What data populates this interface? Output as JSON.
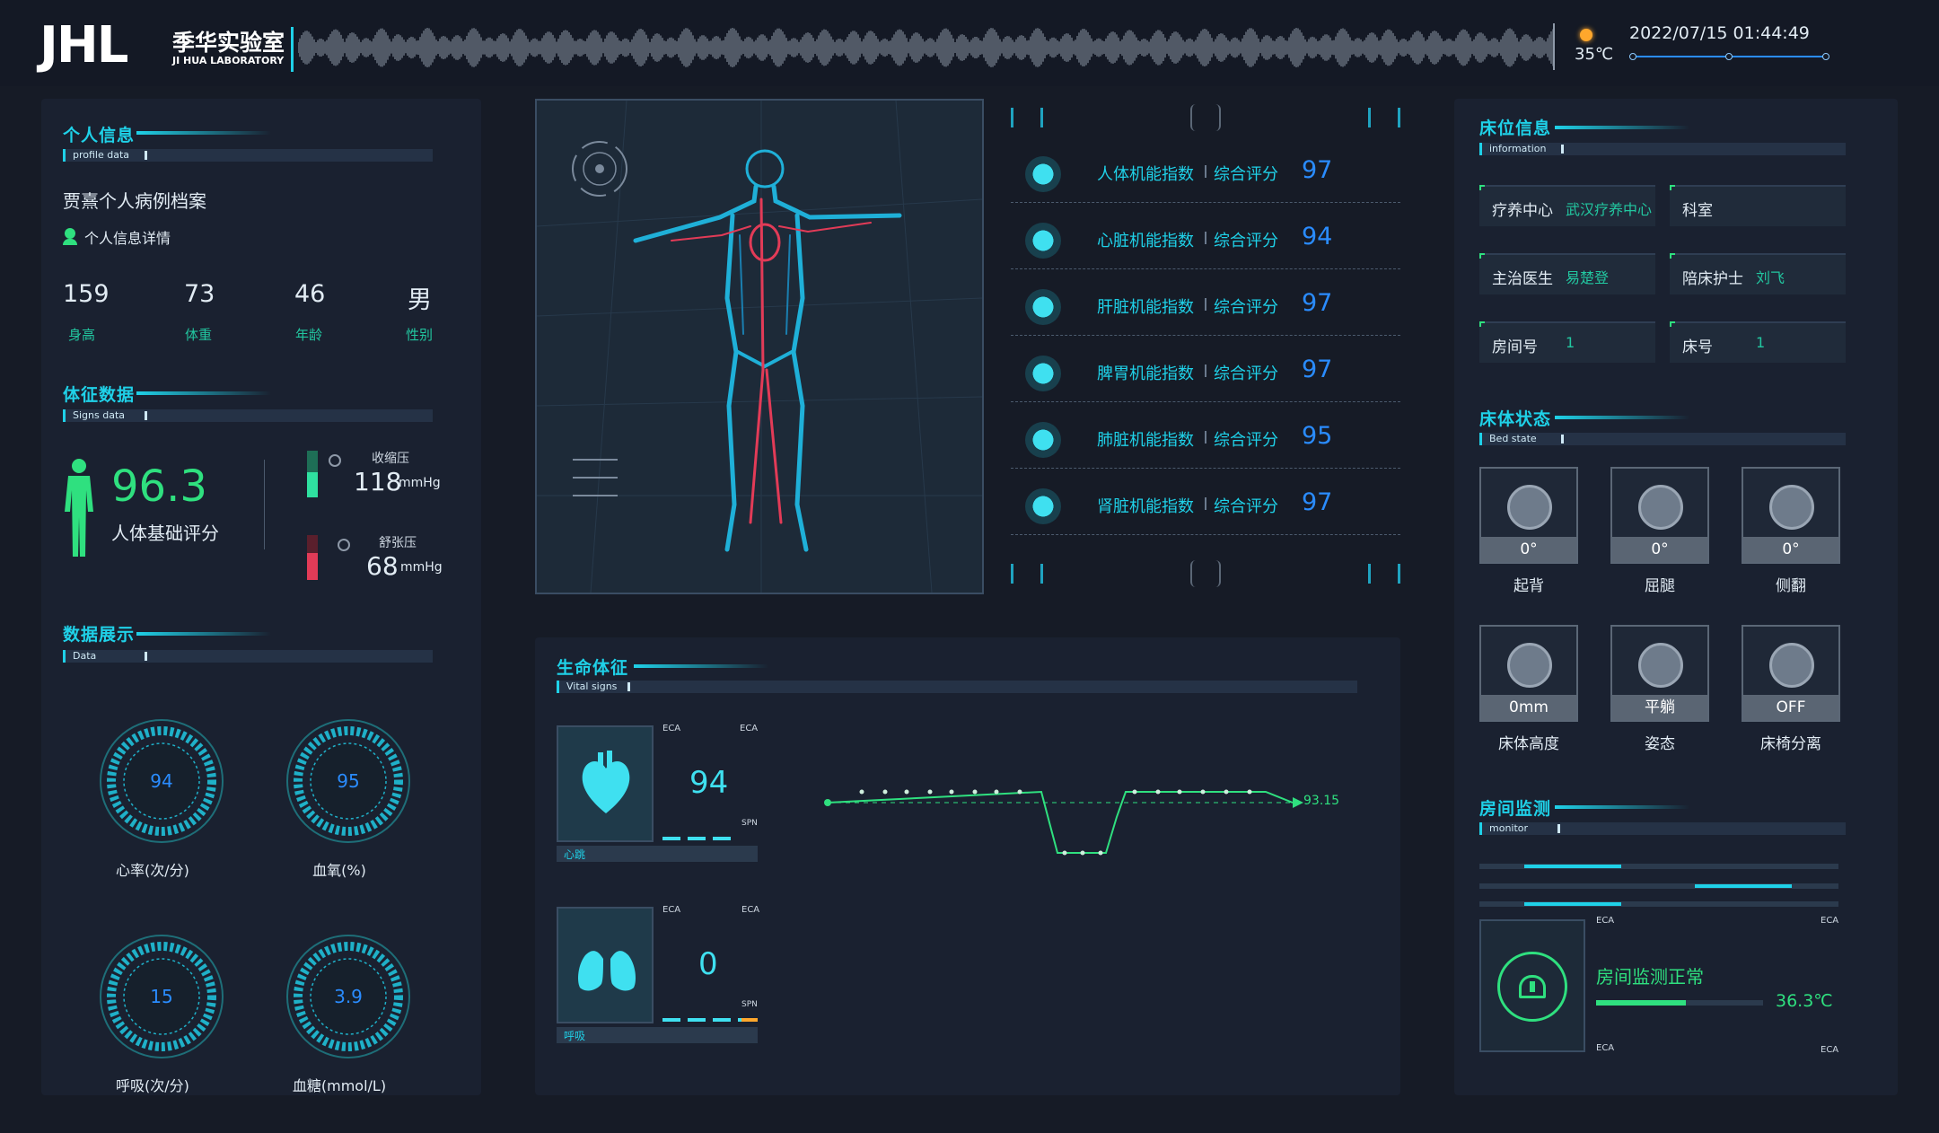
{
  "header": {
    "logo": "JHL",
    "lab_name_cn": "季华实验室",
    "lab_name_en": "JI HUA LABORATORY",
    "temperature": "35℃",
    "datetime": "2022/07/15 01:44:49"
  },
  "personal": {
    "title": "个人信息",
    "subtitle": "profile data",
    "record_title": "贾熹个人病例档案",
    "detail_link": "个人信息详情",
    "stats": [
      {
        "value": "159",
        "label": "身高"
      },
      {
        "value": "73",
        "label": "体重"
      },
      {
        "value": "46",
        "label": "年龄"
      },
      {
        "value": "男",
        "label": "性别"
      }
    ]
  },
  "signs": {
    "title": "体征数据",
    "subtitle": "Signs data",
    "score": "96.3",
    "score_label": "人体基础评分",
    "systolic_label": "收缩压",
    "systolic_value": "118",
    "systolic_unit": "mmHg",
    "diastolic_label": "舒张压",
    "diastolic_value": "68",
    "diastolic_unit": "mmHg"
  },
  "data_display": {
    "title": "数据展示",
    "subtitle": "Data",
    "gauges": [
      {
        "value": "94",
        "label": "心率(次/分)"
      },
      {
        "value": "95",
        "label": "血氧(%)"
      },
      {
        "value": "15",
        "label": "呼吸(次/分)"
      },
      {
        "value": "3.9",
        "label": "血糖(mmol/L)"
      }
    ]
  },
  "organs": {
    "score_label": "综合评分",
    "items": [
      {
        "name": "人体机能指数",
        "score": "97",
        "icon": "body-icon"
      },
      {
        "name": "心脏机能指数",
        "score": "94",
        "icon": "heart-icon"
      },
      {
        "name": "肝脏机能指数",
        "score": "97",
        "icon": "liver-icon"
      },
      {
        "name": "脾胃机能指数",
        "score": "97",
        "icon": "stomach-icon"
      },
      {
        "name": "肺脏机能指数",
        "score": "95",
        "icon": "lungs-icon"
      },
      {
        "name": "肾脏机能指数",
        "score": "97",
        "icon": "kidney-icon"
      }
    ]
  },
  "vitals": {
    "title": "生命体征",
    "subtitle": "Vital signs",
    "eca": "ECA",
    "spn": "SPN",
    "heart_label": "心跳",
    "heart_value": "94",
    "breath_label": "呼吸",
    "breath_value": "0",
    "ecg_value": "93.15"
  },
  "bed_info": {
    "title": "床位信息",
    "subtitle": "information",
    "fields": [
      {
        "key": "疗养中心",
        "value": "武汉疗养中心"
      },
      {
        "key": "科室",
        "value": ""
      },
      {
        "key": "主治医生",
        "value": "易楚登"
      },
      {
        "key": "陪床护士",
        "value": "刘飞"
      },
      {
        "key": "房间号",
        "value": "1"
      },
      {
        "key": "床号",
        "value": "1"
      }
    ]
  },
  "bed_state": {
    "title": "床体状态",
    "subtitle": "Bed state",
    "tiles": [
      {
        "value": "0°",
        "label": "起背",
        "icon": "back-raise-icon"
      },
      {
        "value": "0°",
        "label": "屈腿",
        "icon": "leg-bend-icon"
      },
      {
        "value": "0°",
        "label": "侧翻",
        "icon": "side-turn-icon"
      },
      {
        "value": "0mm",
        "label": "床体高度",
        "icon": "bed-height-icon"
      },
      {
        "value": "平躺",
        "label": "姿态",
        "icon": "posture-icon"
      },
      {
        "value": "OFF",
        "label": "床椅分离",
        "icon": "chair-separate-icon"
      }
    ]
  },
  "room": {
    "title": "房间监测",
    "subtitle": "monitor",
    "eca": "ECA",
    "status": "房间监测正常",
    "temperature": "36.3℃"
  },
  "colors": {
    "accent": "#1fd1e8",
    "green": "#2fe07f",
    "blue": "#2a8cff",
    "red": "#e23b57"
  }
}
